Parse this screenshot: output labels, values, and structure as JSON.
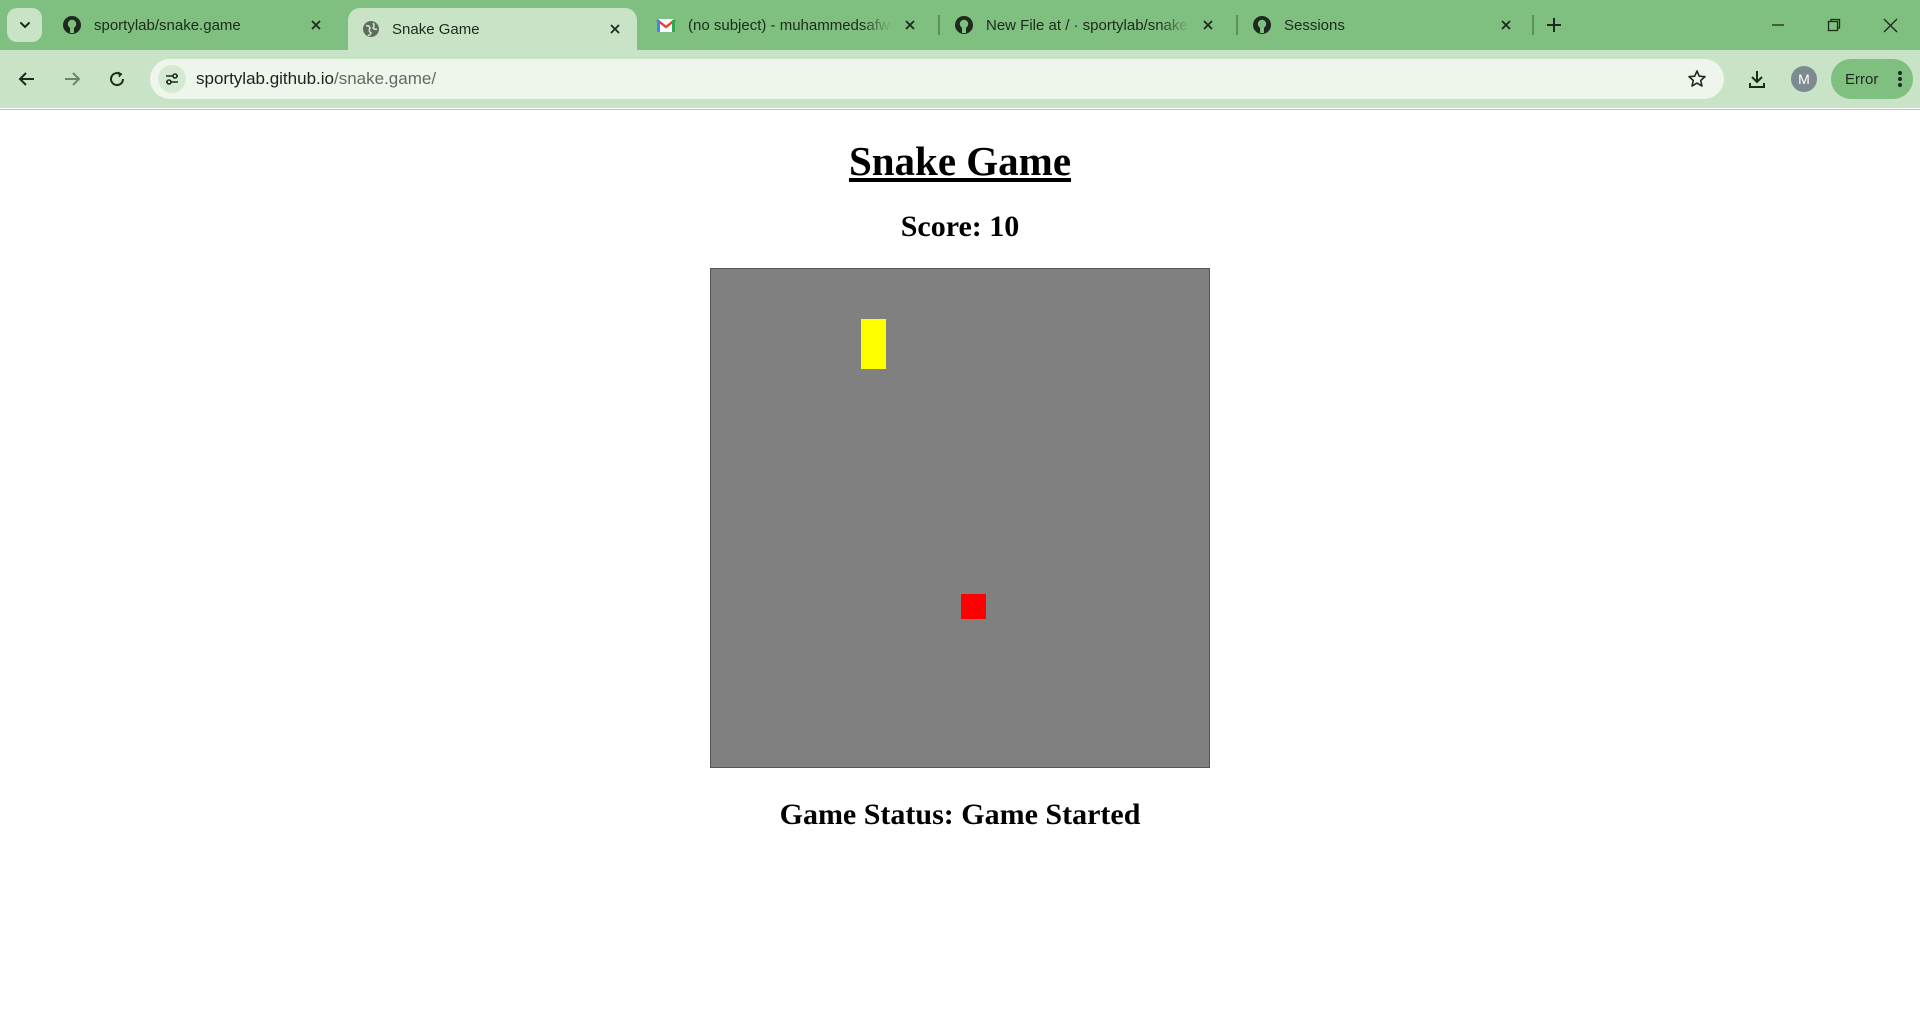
{
  "browser": {
    "tabs": [
      {
        "title": "sportylab/snake.game",
        "icon": "github-icon",
        "active": false
      },
      {
        "title": "Snake Game",
        "icon": "globe-icon",
        "active": true
      },
      {
        "title": "(no subject) - muhammedsafwan",
        "icon": "gmail-icon",
        "active": false
      },
      {
        "title": "New File at / · sportylab/snake.game",
        "icon": "github-icon",
        "active": false
      },
      {
        "title": "Sessions",
        "icon": "github-icon",
        "active": false
      }
    ],
    "url_host": "sportylab.github.io",
    "url_path": "/snake.game/",
    "profile_initial": "M",
    "error_label": "Error",
    "colors": {
      "frame": "#7fbf7f",
      "toolbar": "#c8e3c6",
      "omnibox": "#eef6ec"
    }
  },
  "page": {
    "title": "Snake Game",
    "score": "Score: 10",
    "status": "Game Status: Game Started"
  },
  "game": {
    "grid_size": 20,
    "board_color": "#808080",
    "snake_color": "#ffff00",
    "food_color": "#ff0000",
    "snake": [
      [
        6,
        2
      ],
      [
        6,
        3
      ]
    ],
    "food": [
      10,
      13
    ]
  }
}
